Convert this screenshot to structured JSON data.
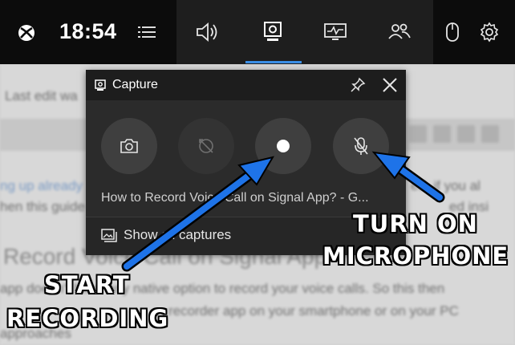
{
  "background_document": {
    "lines": [
      "Last edit wa",
      "ng up already",
      "hen this guide",
      "Record Voice Call on Signal App",
      "app doesn't have any native option to record your voice calls. So this then",
      "recorder app on your smartphone or on your PC",
      "approaches"
    ],
    "right_fragments": [
      "ed, if you al",
      "ed insi"
    ]
  },
  "topbar": {
    "time": "18:54",
    "icons": {
      "logo": "xbox-logo-icon",
      "menu": "menu-lines-icon",
      "audio": "speaker-icon",
      "capture": "webcam-capture-icon",
      "performance": "monitor-performance-icon",
      "social": "people-icon",
      "mouse": "mouse-icon",
      "settings": "gear-icon"
    },
    "accent_color": "#3a8ee6"
  },
  "capture_panel": {
    "title": "Capture",
    "buttons": {
      "screenshot": "camera-icon",
      "record_last": "record-last-30s-icon",
      "start_recording": "record-dot-icon",
      "microphone": "microphone-off-icon"
    },
    "latest_capture_title": "How to Record Voice Call on Signal App? - G...",
    "show_all_captures": "Show all captures"
  },
  "annotations": {
    "start_recording": [
      "START",
      "RECORDING"
    ],
    "turn_on_microphone": [
      "TURN ON",
      "MICROPHONE"
    ],
    "arrow_color": "#1e73e8"
  }
}
